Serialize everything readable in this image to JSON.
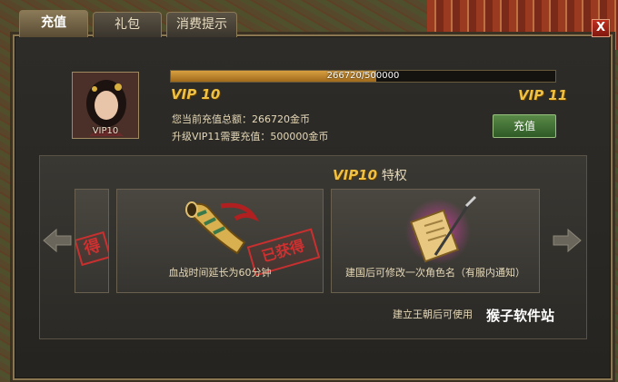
{
  "tabs": [
    {
      "label": "充值",
      "active": true
    },
    {
      "label": "礼包",
      "active": false
    },
    {
      "label": "消费提示",
      "active": false
    }
  ],
  "close_label": "X",
  "portrait": {
    "label": "VIP10"
  },
  "progress": {
    "text": "266720/500000",
    "current": 266720,
    "max": 500000
  },
  "vip_current": "VIP 10",
  "vip_next": "VIP 11",
  "info": {
    "total": "您当前充值总额：266720金币",
    "needed": "升级VIP11需要充值：500000金币"
  },
  "recharge_label": "充值",
  "privilege": {
    "vip": "VIP10",
    "title": "特权"
  },
  "cards": [
    {
      "caption": "",
      "stamp": "得"
    },
    {
      "caption": "血战时间延长为60分钟",
      "stamp": "已获得",
      "icon": "war-horn-icon"
    },
    {
      "caption": "建国后可修改一次角色名（有服内通知）",
      "icon": "scroll-quill-icon"
    }
  ],
  "footnote": "建立王朝后可使用",
  "watermark": "猴子软件站",
  "colors": {
    "gold": "#f0c040",
    "text": "#e6d9b8",
    "stamp": "#c83030",
    "button": "#3e6a34"
  }
}
